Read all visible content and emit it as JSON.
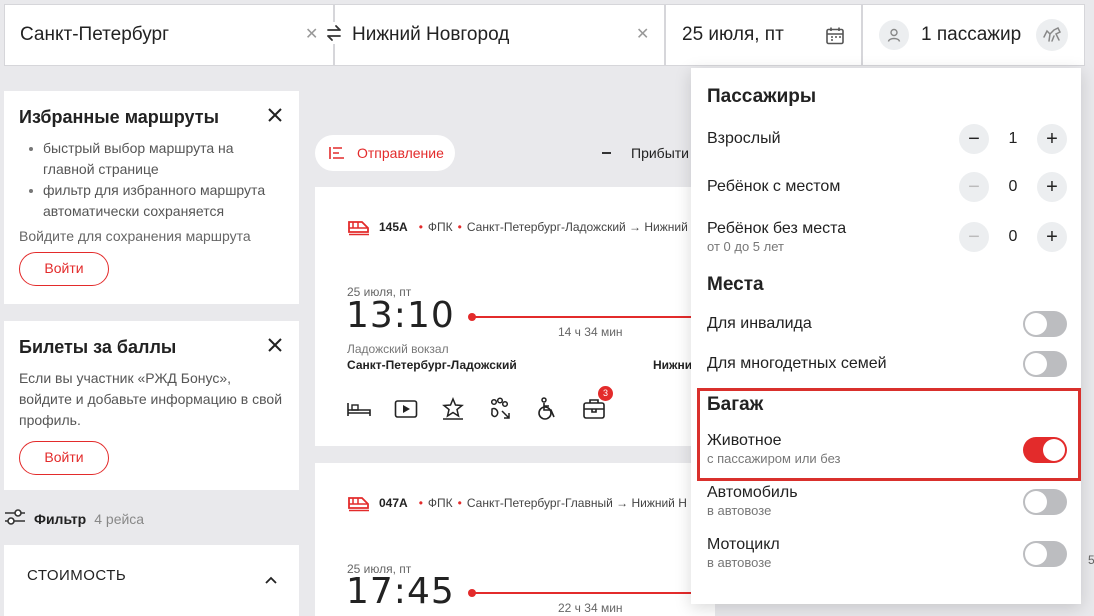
{
  "search": {
    "from": "Санкт-Петербург",
    "to": "Нижний Новгород",
    "date": "25 июля, пт",
    "passengers": "1 пассажир"
  },
  "favorites": {
    "title": "Избранные маршруты",
    "bullets": [
      "быстрый выбор маршрута на главной странице",
      "фильтр для избранного маршрута автоматически сохраняется"
    ],
    "note": "Войдите для сохранения маршрута",
    "login": "Войти"
  },
  "points": {
    "title": "Билеты за баллы",
    "text": "Если вы участник «РЖД Бонус», войдите и добавьте информацию в свой профиль.",
    "login": "Войти"
  },
  "filter": {
    "label": "Фильтр",
    "count": "4 рейса"
  },
  "cost": {
    "label": "СТОИМОСТЬ"
  },
  "sort": {
    "departure": "Отправление",
    "arrival": "Прибыти"
  },
  "trains": [
    {
      "number": "145А",
      "carrier": "ФПК",
      "route": "Санкт-Петербург-Ладожский → Нижний",
      "date": "25 июля, пт",
      "time": "13:10",
      "duration": "14 ч 34 мин",
      "station": "Ладожский вокзал",
      "city": "Санкт-Петербург-Ладожский",
      "dest": "Нижни",
      "badge": "3"
    },
    {
      "number": "047А",
      "carrier": "ФПК",
      "route": "Санкт-Петербург-Главный → Нижний Н",
      "date": "25 июля, пт",
      "time": "17:45",
      "duration": "22 ч 34 мин"
    }
  ],
  "peek": {
    "top": "то",
    "bottom": "5"
  },
  "dropdown": {
    "passengers_title": "Пассажиры",
    "adult": {
      "label": "Взрослый",
      "value": "1"
    },
    "child_seat": {
      "label": "Ребёнок с местом",
      "value": "0"
    },
    "child_noseat": {
      "label": "Ребёнок без места",
      "sub": "от 0 до 5 лет",
      "value": "0"
    },
    "places_title": "Места",
    "disabled": {
      "label": "Для инвалида"
    },
    "large_family": {
      "label": "Для многодетных семей"
    },
    "luggage_title": "Багаж",
    "animal": {
      "label": "Животное",
      "sub": "с пассажиром или без"
    },
    "car": {
      "label": "Автомобиль",
      "sub": "в автовозе"
    },
    "moto": {
      "label": "Мотоцикл",
      "sub": "в автовозе"
    }
  },
  "toggles": {
    "disabled": false,
    "large_family": false,
    "animal": true,
    "car": false,
    "moto": false
  },
  "colors": {
    "accent": "#e32b2b",
    "highlight": "#d9302c"
  }
}
